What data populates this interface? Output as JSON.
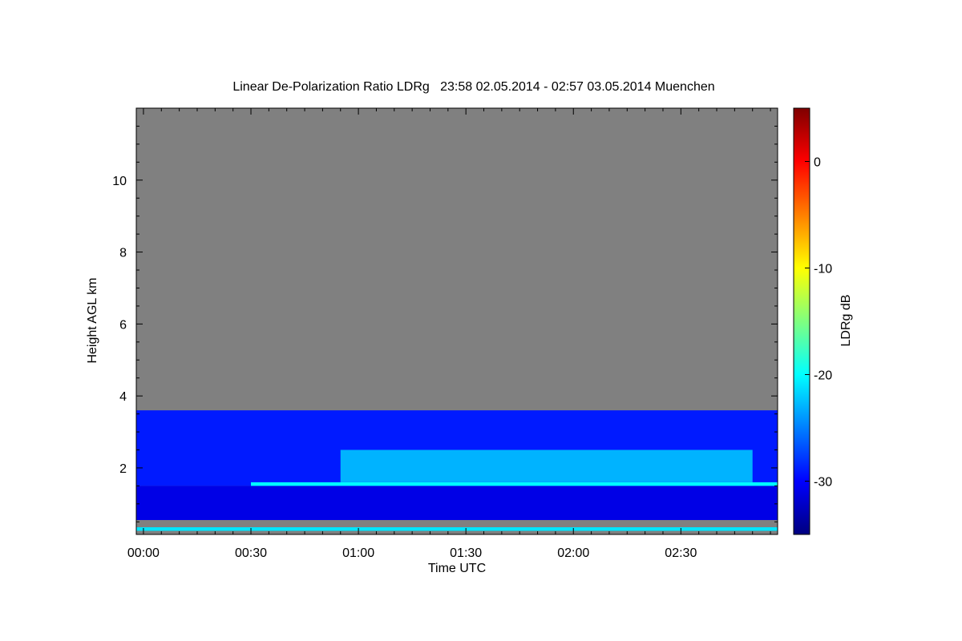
{
  "chart_data": {
    "type": "heatmap",
    "title": "Linear De-Polarization Ratio LDRg   23:58 02.05.2014 - 02:57 03.05.2014 Muenchen",
    "xlabel": "Time UTC",
    "ylabel": "Height AGL km",
    "x_ticks": [
      {
        "label": "00:00",
        "value": 0
      },
      {
        "label": "00:30",
        "value": 30
      },
      {
        "label": "01:00",
        "value": 60
      },
      {
        "label": "01:30",
        "value": 90
      },
      {
        "label": "02:00",
        "value": 120
      },
      {
        "label": "02:30",
        "value": 150
      }
    ],
    "y_ticks": [
      {
        "label": "2",
        "value": 2
      },
      {
        "label": "4",
        "value": 4
      },
      {
        "label": "6",
        "value": 6
      },
      {
        "label": "8",
        "value": 8
      },
      {
        "label": "10",
        "value": 10
      }
    ],
    "xlim_minutes_utc": [
      -2,
      177
    ],
    "ylim_km": [
      0.15,
      12
    ],
    "colorbar": {
      "label": "LDRg dB",
      "ticks": [
        {
          "label": "0",
          "value": 0
        },
        {
          "label": "-10",
          "value": -10
        },
        {
          "label": "-20",
          "value": -20
        },
        {
          "label": "-30",
          "value": -30
        }
      ],
      "range_db": [
        -35,
        5
      ],
      "colormap": "jet"
    },
    "no_data_color": "#808080",
    "features": [
      {
        "name": "upper-cloud-layer",
        "time_min": [
          -2,
          177
        ],
        "height_km": [
          1.5,
          3.6
        ],
        "ldr_db": -29
      },
      {
        "name": "lower-layer",
        "time_min": [
          -2,
          177
        ],
        "height_km": [
          0.55,
          1.5
        ],
        "ldr_db": -31
      },
      {
        "name": "melting-layer-band",
        "time_min": [
          30,
          177
        ],
        "height_km": [
          1.5,
          1.6
        ],
        "ldr_db": -20
      },
      {
        "name": "fall-streaks",
        "time_min": [
          55,
          170
        ],
        "height_km": [
          1.6,
          2.5
        ],
        "ldr_db": -23
      },
      {
        "name": "surface-band",
        "time_min": [
          -2,
          177
        ],
        "height_km": [
          0.25,
          0.35
        ],
        "ldr_db": -21
      }
    ]
  }
}
